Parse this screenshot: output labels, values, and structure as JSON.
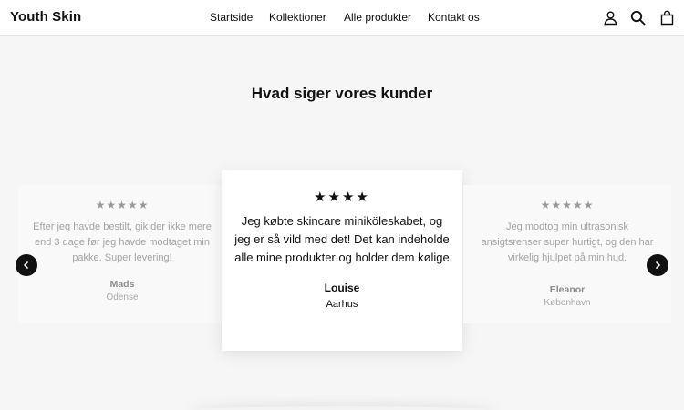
{
  "header": {
    "logo": "Youth Skin",
    "nav": [
      "Startside",
      "Kollektioner",
      "Alle produkter",
      "Kontakt os"
    ],
    "icons": [
      "user-icon",
      "search-icon",
      "cart-icon"
    ]
  },
  "testimonials": {
    "title": "Hvad siger vores kunder",
    "items": [
      {
        "stars": "★★★★★",
        "rating": 5,
        "quote": "Efter jeg havde bestilt, gik der ikke mere end 3 dage før jeg havde modtaget min pakke. Super levering!",
        "author": "Mads",
        "city": "Odense"
      },
      {
        "stars": "★★★★",
        "rating": 4,
        "quote": "Jeg købte skincare miniköleskabet, og jeg er så vild med det! Det kan indeholde alle mine produkter og holder dem kølige",
        "author": "Louise",
        "city": "Aarhus"
      },
      {
        "stars": "★★★★★",
        "rating": 5,
        "quote": "Jeg modtog min ultrasonisk ansigtsrenser super hurtigt, og den har virkelig hjulpet på min hud.",
        "author": "Eleanor",
        "city": "København"
      }
    ]
  },
  "colors": {
    "background": "#f6f6f6",
    "text": "#111111",
    "muted": "#a8a8a8"
  }
}
